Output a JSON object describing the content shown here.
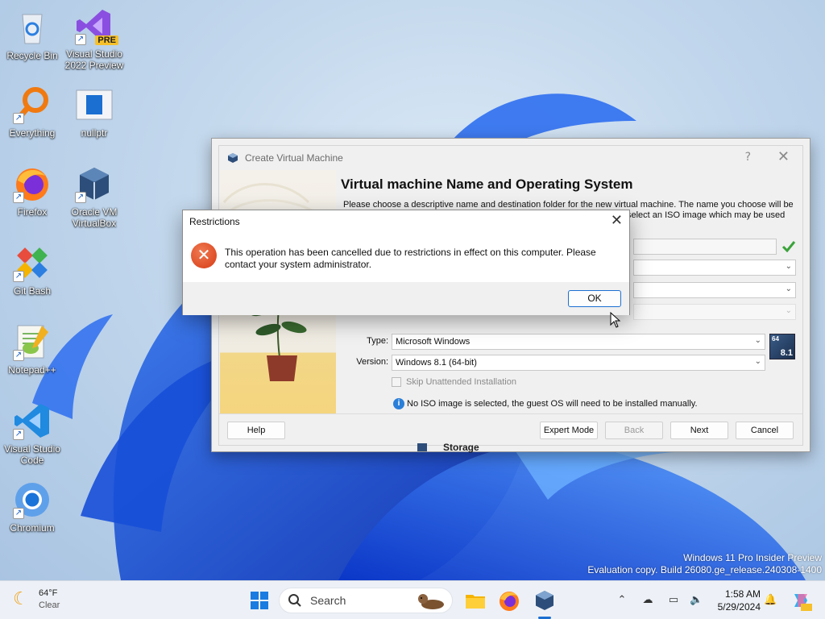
{
  "desktop": {
    "icons": [
      {
        "label": "Recycle Bin"
      },
      {
        "label": "Visual Studio 2022 Preview",
        "badge": "PRE"
      },
      {
        "label": "Everything"
      },
      {
        "label": "nullptr"
      },
      {
        "label": "Firefox"
      },
      {
        "label": "Oracle VM VirtualBox"
      },
      {
        "label": "Git Bash"
      },
      {
        "label": "Notepad++"
      },
      {
        "label": "Visual Studio Code"
      },
      {
        "label": "Chromium"
      }
    ],
    "watermark": {
      "line1": "Windows 11 Pro Insider Preview",
      "line2": "Evaluation copy. Build 26080.ge_release.240308-1400"
    }
  },
  "vbox_wizard": {
    "window_title": "Create Virtual Machine",
    "help_glyph": "?",
    "close_glyph": "✕",
    "heading": "Virtual machine Name and Operating System",
    "description_line1": "Please choose a descriptive name and destination folder for the new virtual machine. The name you choose will be",
    "description_line2": "select an ISO image which may be used",
    "type_label": "Type:",
    "type_value": "Microsoft Windows",
    "version_label": "Version:",
    "version_value": "Windows 8.1 (64-bit)",
    "os_badge_bits": "64",
    "os_badge_version": "8.1",
    "skip_unattended_label": "Skip Unattended Installation",
    "iso_note": "No ISO image is selected, the guest OS will need to be installed manually.",
    "buttons": {
      "help": "Help",
      "expert": "Expert Mode",
      "back": "Back",
      "next": "Next",
      "cancel": "Cancel"
    },
    "storage_peek": "Storage"
  },
  "restrictions_dialog": {
    "title": "Restrictions",
    "close_glyph": "✕",
    "message_line1": "This operation has been cancelled due to restrictions in effect on this computer. Please",
    "message_line2": "contact your system administrator.",
    "ok_label": "OK"
  },
  "taskbar": {
    "weather": {
      "temp": "64°F",
      "condition": "Clear"
    },
    "search_label": "Search",
    "clock": {
      "time": "1:58 AM",
      "date": "5/29/2024"
    }
  },
  "colors": {
    "accent": "#1b6fd1",
    "error": "#d63b14",
    "wallpaper_blue": "#1a4fd6"
  }
}
